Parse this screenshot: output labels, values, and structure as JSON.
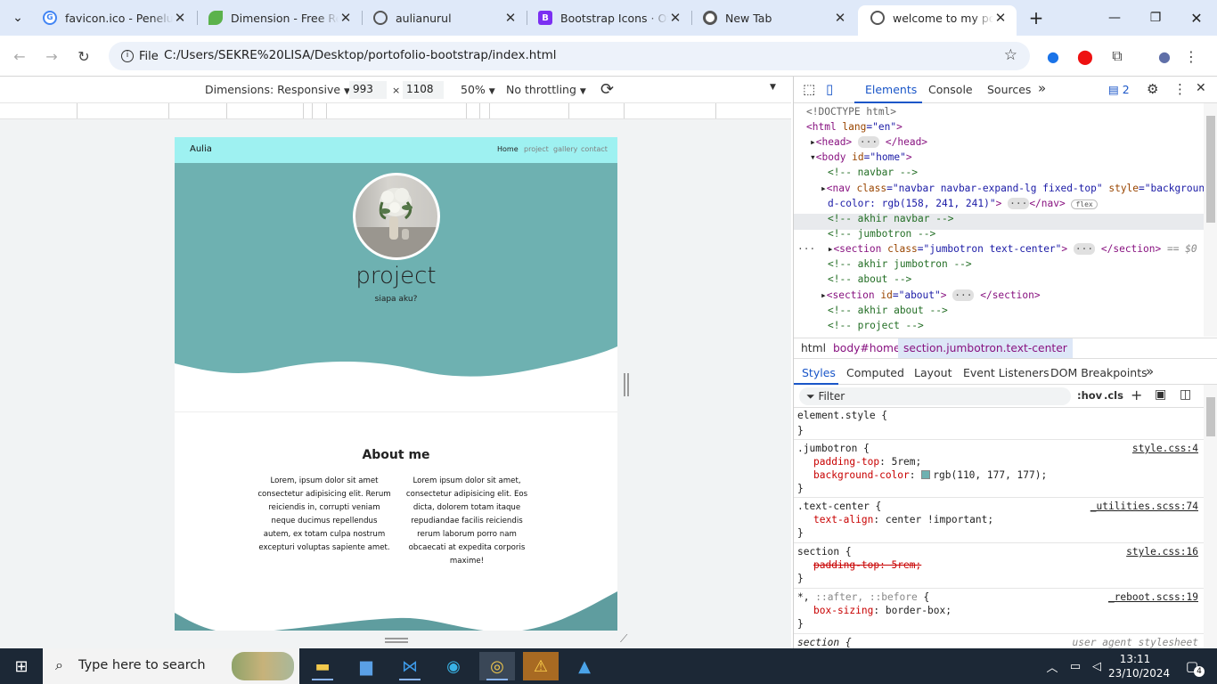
{
  "browser": {
    "tabs": [
      {
        "title": "favicon.ico - Penelusu",
        "favicon": "google-icon",
        "active": false
      },
      {
        "title": "Dimension - Free Resp",
        "favicon": "leaf-icon",
        "active": false
      },
      {
        "title": "aulianurul",
        "favicon": "globe-icon",
        "active": false
      },
      {
        "title": "Bootstrap Icons · Offi",
        "favicon": "bootstrap-icon",
        "active": false
      },
      {
        "title": "New Tab",
        "favicon": "chrome-icon",
        "active": false
      },
      {
        "title": "welcome to my porto",
        "favicon": "globe-icon",
        "active": true
      }
    ],
    "new_tab": "+",
    "omnibox": {
      "scheme_label": "File",
      "url": "C:/Users/SEKRE%20LISA/Desktop/portofolio-bootstrap/index.html"
    }
  },
  "device_toolbar": {
    "dimensions": "Dimensions: Responsive",
    "width": "993",
    "times": "×",
    "height": "1108",
    "zoom": "50%",
    "throttling": "No throttling"
  },
  "site": {
    "brand": "Aulia",
    "nav": [
      "Home",
      "project",
      "gallery",
      "contact"
    ],
    "jumbotron": {
      "title": "project",
      "subtitle": "siapa aku?"
    },
    "about": {
      "title": "About me",
      "col1": "Lorem, ipsum dolor sit amet consectetur adipisicing elit. Rerum reiciendis in, corrupti veniam neque ducimus repellendus autem, ex totam culpa nostrum excepturi voluptas sapiente amet.",
      "col2": "Lorem ipsum dolor sit amet, consectetur adipisicing elit. Eos dicta, dolorem totam itaque repudiandae facilis reiciendis rerum laborum porro nam obcaecati at expedita corporis maxime!"
    },
    "colors": {
      "navbar": "#9ef1f1",
      "jumbotron": "#6eb1b1"
    }
  },
  "devtools": {
    "tabs": [
      "Elements",
      "Console",
      "Sources"
    ],
    "more": "»",
    "issues": "2",
    "dom": {
      "l1": "<!DOCTYPE html>",
      "l2a": "<html ",
      "l2b": "lang",
      "l2c": "=\"en\"",
      "l2d": ">",
      "l3a": "<head>",
      "l3b": "</head>",
      "l4a": "<body ",
      "l4b": "id",
      "l4c": "=\"home\"",
      "l4d": ">",
      "l5": "<!-- navbar -->",
      "l6a": "<nav ",
      "l6b": "class",
      "l6c": "=\"navbar navbar-expand-lg fixed-top\"",
      "l6d": " style",
      "l6e": "=\"backgroun",
      "l7a": "d-color: rgb(158, 241, 241)\"",
      "l7b": "</nav>",
      "l7c": "flex",
      "l8": "<!-- akhir navbar -->",
      "l9": "<!-- jumbotron -->",
      "l10a": "<section ",
      "l10b": "class",
      "l10c": "=\"jumbotron text-center\"",
      "l10d": ">",
      "l10e": "</section>",
      "l10f": "== $0",
      "l11": "<!-- akhir jumbotron -->",
      "l12": "<!-- about -->",
      "l13a": "<section ",
      "l13b": "id",
      "l13c": "=\"about\"",
      "l13d": ">",
      "l13e": "</section>",
      "l14": "<!-- akhir about -->",
      "l15": "<!-- project -->"
    },
    "breadcrumbs": [
      "html",
      "body#home",
      "section.jumbotron.text-center"
    ],
    "style_tabs": [
      "Styles",
      "Computed",
      "Layout",
      "Event Listeners",
      "DOM Breakpoints"
    ],
    "filter_placeholder": "Filter",
    "hov": ":hov",
    "cls": ".cls",
    "rules": {
      "r1_sel": "element.style {",
      "r2_sel": ".jumbotron {",
      "r2_src": "style.css:4",
      "r2_p1": "padding-top",
      "r2_v1": "5rem;",
      "r2_p2": "background-color",
      "r2_v2": "rgb(110, 177, 177);",
      "r3_sel": ".text-center {",
      "r3_src": "_utilities.scss:74",
      "r3_p1": "text-align",
      "r3_v1": "center !important;",
      "r4_sel": "section {",
      "r4_src": "style.css:16",
      "r4_p1": "padding-top: 5rem;",
      "r5_sel": "*, ::after, ::before {",
      "r5_src": "_reboot.scss:19",
      "r5_p1": "box-sizing",
      "r5_v1": "border-box;",
      "r6_sel": "section {",
      "r6_src": "user agent stylesheet",
      "close": "}"
    }
  },
  "taskbar": {
    "search_placeholder": "Type here to search",
    "time": "13:11",
    "date": "23/10/2024",
    "notifications": "4"
  }
}
